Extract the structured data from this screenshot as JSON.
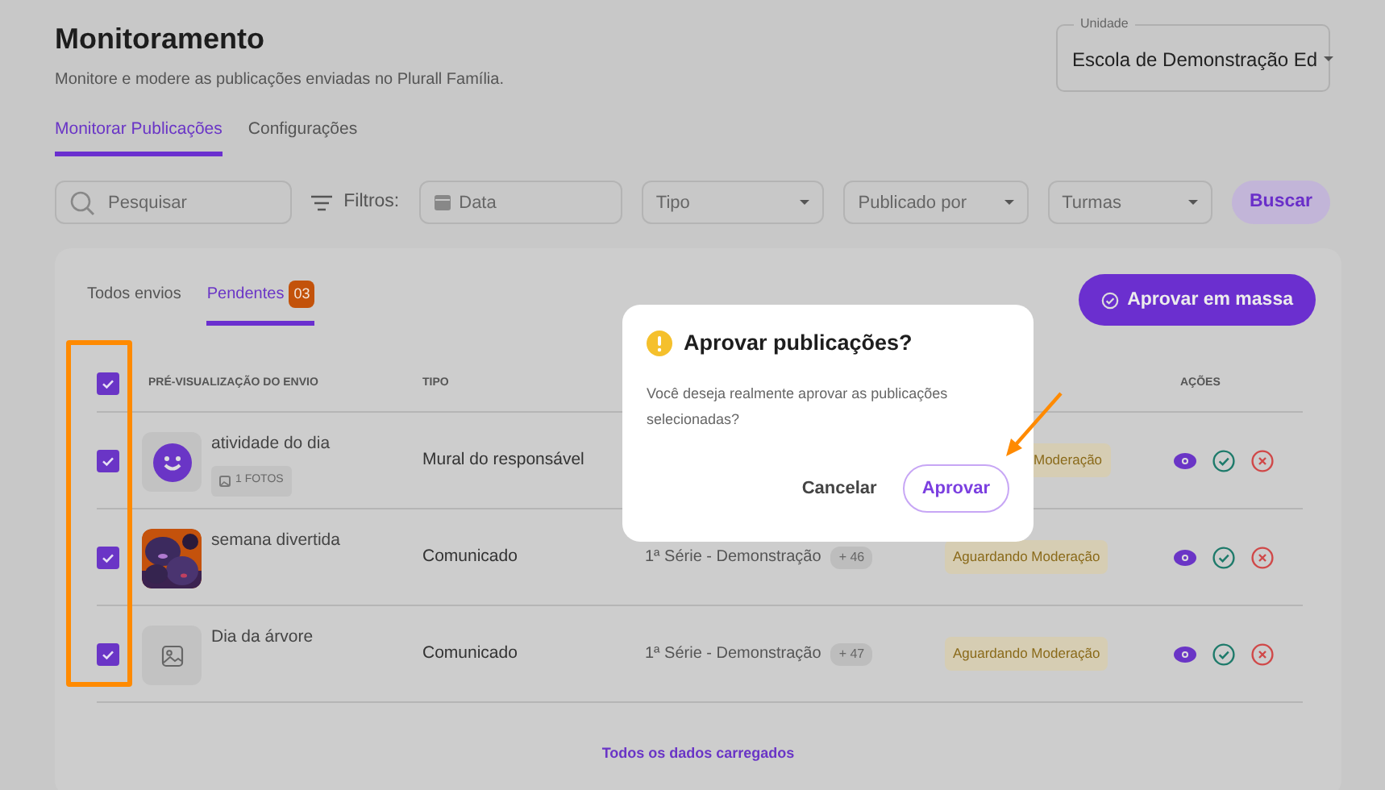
{
  "page": {
    "title": "Monitoramento",
    "subtitle": "Monitore e modere as publicações enviadas no Plurall Família."
  },
  "unit_select": {
    "label": "Unidade",
    "value": "Escola de Demonstração Ed"
  },
  "tabs": [
    {
      "label": "Monitorar Publicações",
      "selected": true
    },
    {
      "label": "Configurações",
      "selected": false
    }
  ],
  "filters": {
    "search_placeholder": "Pesquisar",
    "label": "Filtros:",
    "fields": [
      {
        "kind": "date",
        "placeholder": "Data"
      },
      {
        "kind": "select",
        "placeholder": "Tipo"
      },
      {
        "kind": "select",
        "placeholder": "Publicado por"
      },
      {
        "kind": "select",
        "placeholder": "Turmas"
      }
    ],
    "button": "Buscar"
  },
  "list_tabs": [
    {
      "label": "Todos envios",
      "selected": false
    },
    {
      "label": "Pendentes",
      "selected": true,
      "count": "03"
    }
  ],
  "bulk_button": "Aprovar em massa",
  "table": {
    "select_all_checked": true,
    "columns": [
      {
        "kind": "preview",
        "label": "PRÉ-VISUALIZAÇÃO DO ENVIO"
      },
      {
        "kind": "type",
        "label": "TIPO"
      },
      {
        "kind": "actions",
        "label": "AÇÕES"
      }
    ],
    "rows": [
      {
        "checked": true,
        "thumbnail": {
          "kind": "icon"
        },
        "title": "atividade do dia",
        "attachment": "1 FOTOS",
        "type": "Mural do responsável",
        "status": "Moderação",
        "status_covered": true
      },
      {
        "checked": true,
        "title": "semana divertida",
        "type": "Comunicado",
        "class": "1ª Série - Demonstração",
        "class_extra": "+ 46",
        "status": "Aguardando Moderação",
        "status_covered": false
      },
      {
        "checked": true,
        "thumbnail": {
          "kind": "placeholder"
        },
        "title": "Dia da árvore",
        "type": "Comunicado",
        "class": "1ª Série - Demonstração",
        "class_extra": "+ 47",
        "status": "Aguardando Moderação",
        "status_covered": false
      }
    ]
  },
  "footer": "Todos os dados carregados",
  "dialog": {
    "title": "Aprovar publicações?",
    "message": "Você deseja realmente aprovar as publicações selecionadas?",
    "buttons": [
      {
        "kind": "text",
        "label": "Cancelar"
      },
      {
        "kind": "outline",
        "label": "Aprovar"
      }
    ]
  }
}
